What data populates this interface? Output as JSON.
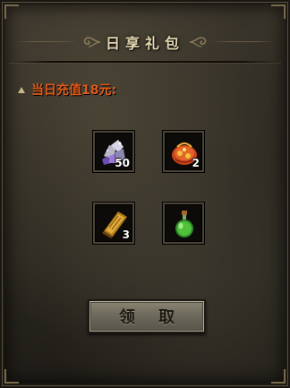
{
  "dialog": {
    "title": "日享礼包",
    "condition": "当日充值18元:",
    "claim_label": "领 取"
  },
  "rewards": [
    {
      "icon": "crystal-ore-icon",
      "count": "50"
    },
    {
      "icon": "treasure-pouch-icon",
      "count": "2"
    },
    {
      "icon": "gold-book-icon",
      "count": "3"
    },
    {
      "icon": "green-potion-icon",
      "count": ""
    }
  ],
  "colors": {
    "condition_text": "#e05a1a",
    "title_text": "#e6d8b0"
  }
}
